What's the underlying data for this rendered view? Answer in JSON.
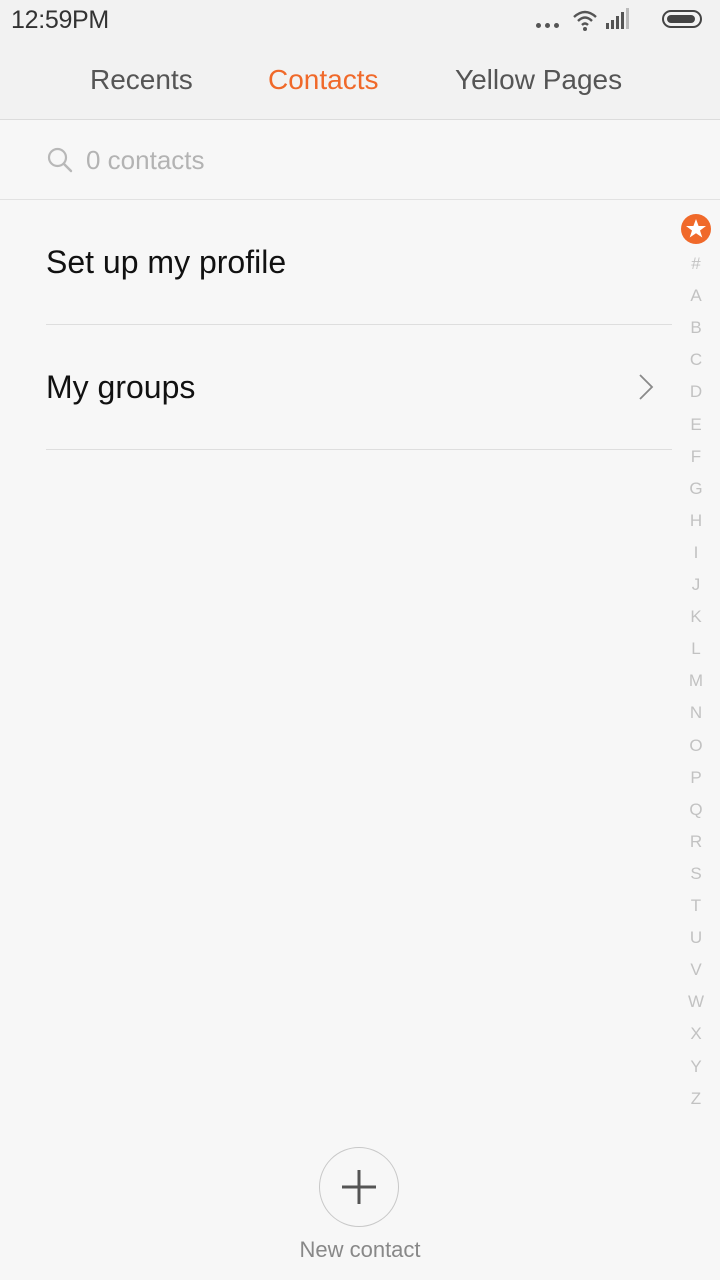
{
  "status_bar": {
    "time": "12:59PM"
  },
  "tabs": [
    {
      "label": "Recents",
      "active": false
    },
    {
      "label": "Contacts",
      "active": true
    },
    {
      "label": "Yellow Pages",
      "active": false
    }
  ],
  "colors": {
    "accent": "#f0692a",
    "tab_inactive": "#555555"
  },
  "search": {
    "placeholder": "0 contacts",
    "value": ""
  },
  "list": {
    "items": [
      {
        "label": "Set up my profile",
        "icon": null
      },
      {
        "label": "My groups",
        "icon": "chevron-right-icon"
      }
    ]
  },
  "alphabet_index": {
    "favorites_icon": "star-icon",
    "letters": [
      "#",
      "A",
      "B",
      "C",
      "D",
      "E",
      "F",
      "G",
      "H",
      "I",
      "J",
      "K",
      "L",
      "M",
      "N",
      "O",
      "P",
      "Q",
      "R",
      "S",
      "T",
      "U",
      "V",
      "W",
      "X",
      "Y",
      "Z"
    ]
  },
  "new_contact": {
    "icon": "plus-icon",
    "label": "New contact"
  }
}
